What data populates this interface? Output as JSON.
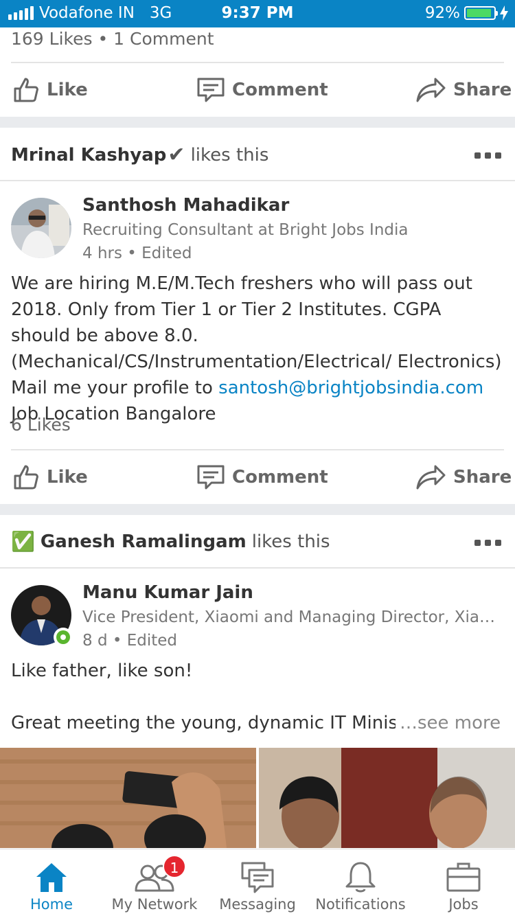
{
  "status_bar": {
    "carrier": "Vodafone IN",
    "network": "3G",
    "time": "9:37 PM",
    "battery": "92%",
    "battery_level": 0.92
  },
  "post1": {
    "counts": "169 Likes • 1 Comment",
    "actions": {
      "like": "Like",
      "comment": "Comment",
      "share": "Share"
    }
  },
  "post2": {
    "liker_name": "Mrinal Kashyap",
    "liker_mark": "✔",
    "liker_suffix": "likes this",
    "author": "Santhosh Mahadikar",
    "headline": "Recruiting Consultant at Bright Jobs India",
    "time": "4 hrs • Edited",
    "body": "We are hiring M.E/M.Tech freshers who will pass out 2018. Only from Tier 1 or Tier 2 Institutes. CGPA should be above 8.0. (Mechanical/CS/Instrumentation/Electrical/ Electronics) Mail me your profile to",
    "email": "santosh@brightjobsindia.com",
    "body_tail": "Job Location Bangalore",
    "counts": "6 Likes",
    "actions": {
      "like": "Like",
      "comment": "Comment",
      "share": "Share"
    }
  },
  "post3": {
    "liker_mark": "✅",
    "liker_name": "Ganesh Ramalingam",
    "liker_suffix": "likes this",
    "author": "Manu Kumar Jain",
    "headline": "Vice President, Xiaomi and Managing Director, Xiaomi India",
    "time": "8 d • Edited",
    "line1": "Like father, like son!",
    "line2": "Great meeting the young, dynamic IT Ministe",
    "see_more": "…see more"
  },
  "tabbar": {
    "home": "Home",
    "network": "My Network",
    "network_badge": "1",
    "messaging": "Messaging",
    "notifications": "Notifications",
    "jobs": "Jobs"
  },
  "colors": {
    "brand": "#0a84c5",
    "badge": "#e5262f",
    "online": "#5ab52f"
  }
}
